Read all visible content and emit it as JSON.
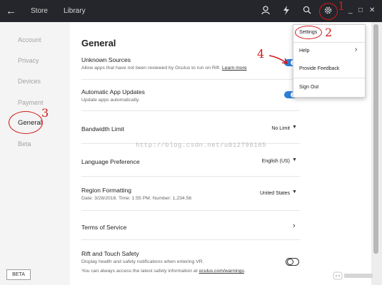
{
  "topbar": {
    "back_icon": "arrow-left-icon",
    "tabs": [
      "Store",
      "Library"
    ],
    "icons": [
      "person-icon",
      "bolt-icon",
      "search-icon",
      "gear-icon"
    ],
    "window_controls": [
      "_",
      "□",
      "✕"
    ]
  },
  "sidebar": {
    "items": [
      "Account",
      "Privacy",
      "Devices",
      "Payment",
      "General",
      "Beta"
    ],
    "active": "General",
    "beta_badge": "BETA"
  },
  "main": {
    "title": "General",
    "unknown_sources": {
      "title": "Unknown Sources",
      "desc": "Allow apps that have not been reviewed by Oculus to run on Rift.",
      "link": "Learn more",
      "enabled": true
    },
    "auto_updates": {
      "title": "Automatic App Updates",
      "desc": "Update apps automatically.",
      "enabled": true
    },
    "bandwidth": {
      "title": "Bandwidth Limit",
      "value": "No Limit"
    },
    "language": {
      "title": "Language Preference",
      "value": "English (US)"
    },
    "region": {
      "title": "Region Formatting",
      "desc": "Date: 3/28/2016. Time: 1:55 PM. Number: 1,234.56",
      "value": "United States"
    },
    "terms": {
      "title": "Terms of Service"
    },
    "safety": {
      "title": "Rift and Touch Safety",
      "desc1": "Display health and safety notifications when entering VR.",
      "desc2_prefix": "You can always access the latest safety information at",
      "desc2_link": "oculus.com/warnings",
      "desc2_suffix": ".",
      "enabled": false
    }
  },
  "menu": {
    "items": [
      "Settings",
      "Help",
      "Provide Feedback",
      "Sign Out"
    ]
  },
  "annotations": [
    "1",
    "2",
    "3",
    "4"
  ],
  "watermark": "http://blog.csdn.net/u012790165",
  "colors": {
    "accent": "#2a7fd6",
    "annotation": "#d01a1a",
    "topbar": "#24262b"
  }
}
